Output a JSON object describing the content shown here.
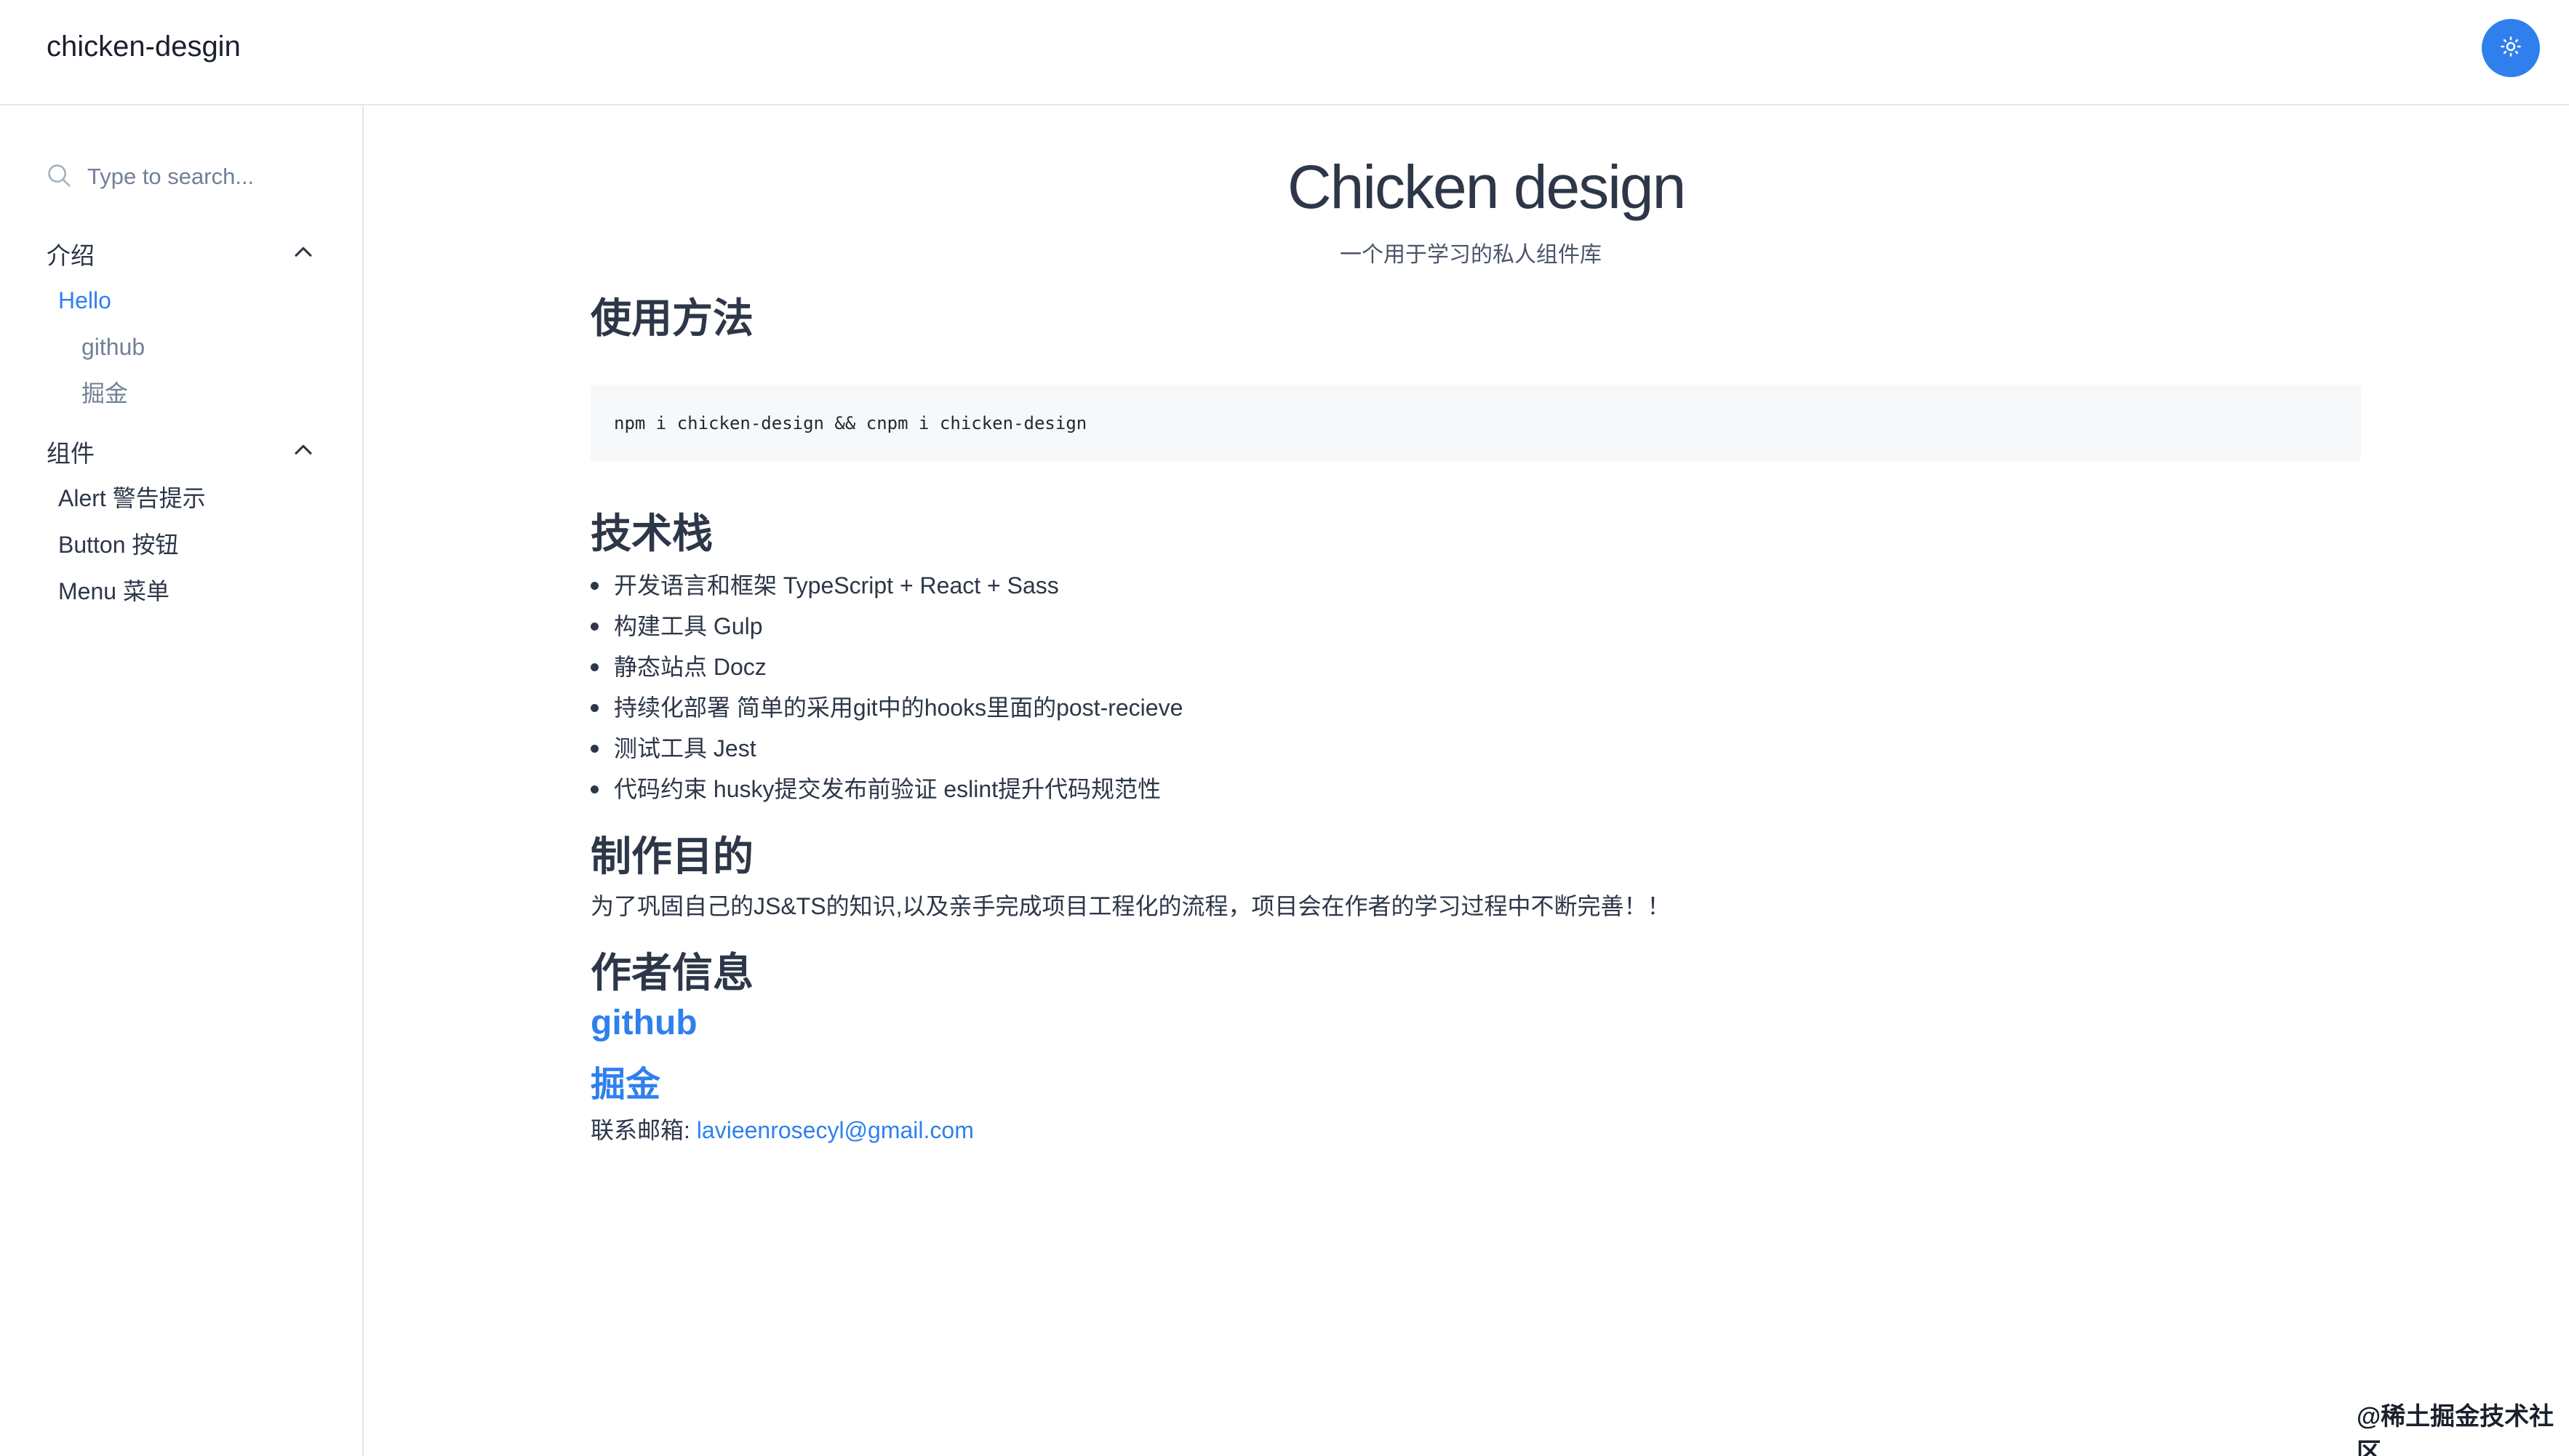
{
  "header": {
    "logo": "chicken-desgin",
    "theme_icon": "sun-icon",
    "accent": "#2f80ed"
  },
  "sidebar": {
    "search_placeholder": "Type to search...",
    "groups": [
      {
        "title": "介绍",
        "items": [
          {
            "label": "Hello",
            "active": true
          },
          {
            "label": "github"
          },
          {
            "label": "掘金"
          }
        ]
      },
      {
        "title": "组件",
        "items": [
          {
            "label": "Alert 警告提示"
          },
          {
            "label": "Button 按钮"
          },
          {
            "label": "Menu 菜单"
          }
        ]
      }
    ]
  },
  "main": {
    "title": "Chicken design",
    "subtitle": "一个用于学习的私人组件库",
    "usage_heading": "使用方法",
    "code": "npm i chicken-design && cnpm i chicken-design",
    "stack_heading": "技术栈",
    "stack_items": [
      "开发语言和框架 TypeScript + React + Sass",
      "构建工具 Gulp",
      "静态站点 Docz",
      "持续化部署 简单的采用git中的hooks里面的post-recieve",
      "测试工具 Jest",
      "代码约束 husky提交发布前验证 eslint提升代码规范性"
    ],
    "purpose_heading": "制作目的",
    "purpose_text": "为了巩固自己的JS&TS的知识,以及亲手完成项目工程化的流程，项目会在作者的学习过程中不断完善！！",
    "author_heading": "作者信息",
    "link_github": "github",
    "link_juejin": "掘金",
    "email_label": "联系邮箱: ",
    "email": "lavieenrosecyl@gmail.com"
  },
  "watermark": "@稀土掘金技术社区"
}
